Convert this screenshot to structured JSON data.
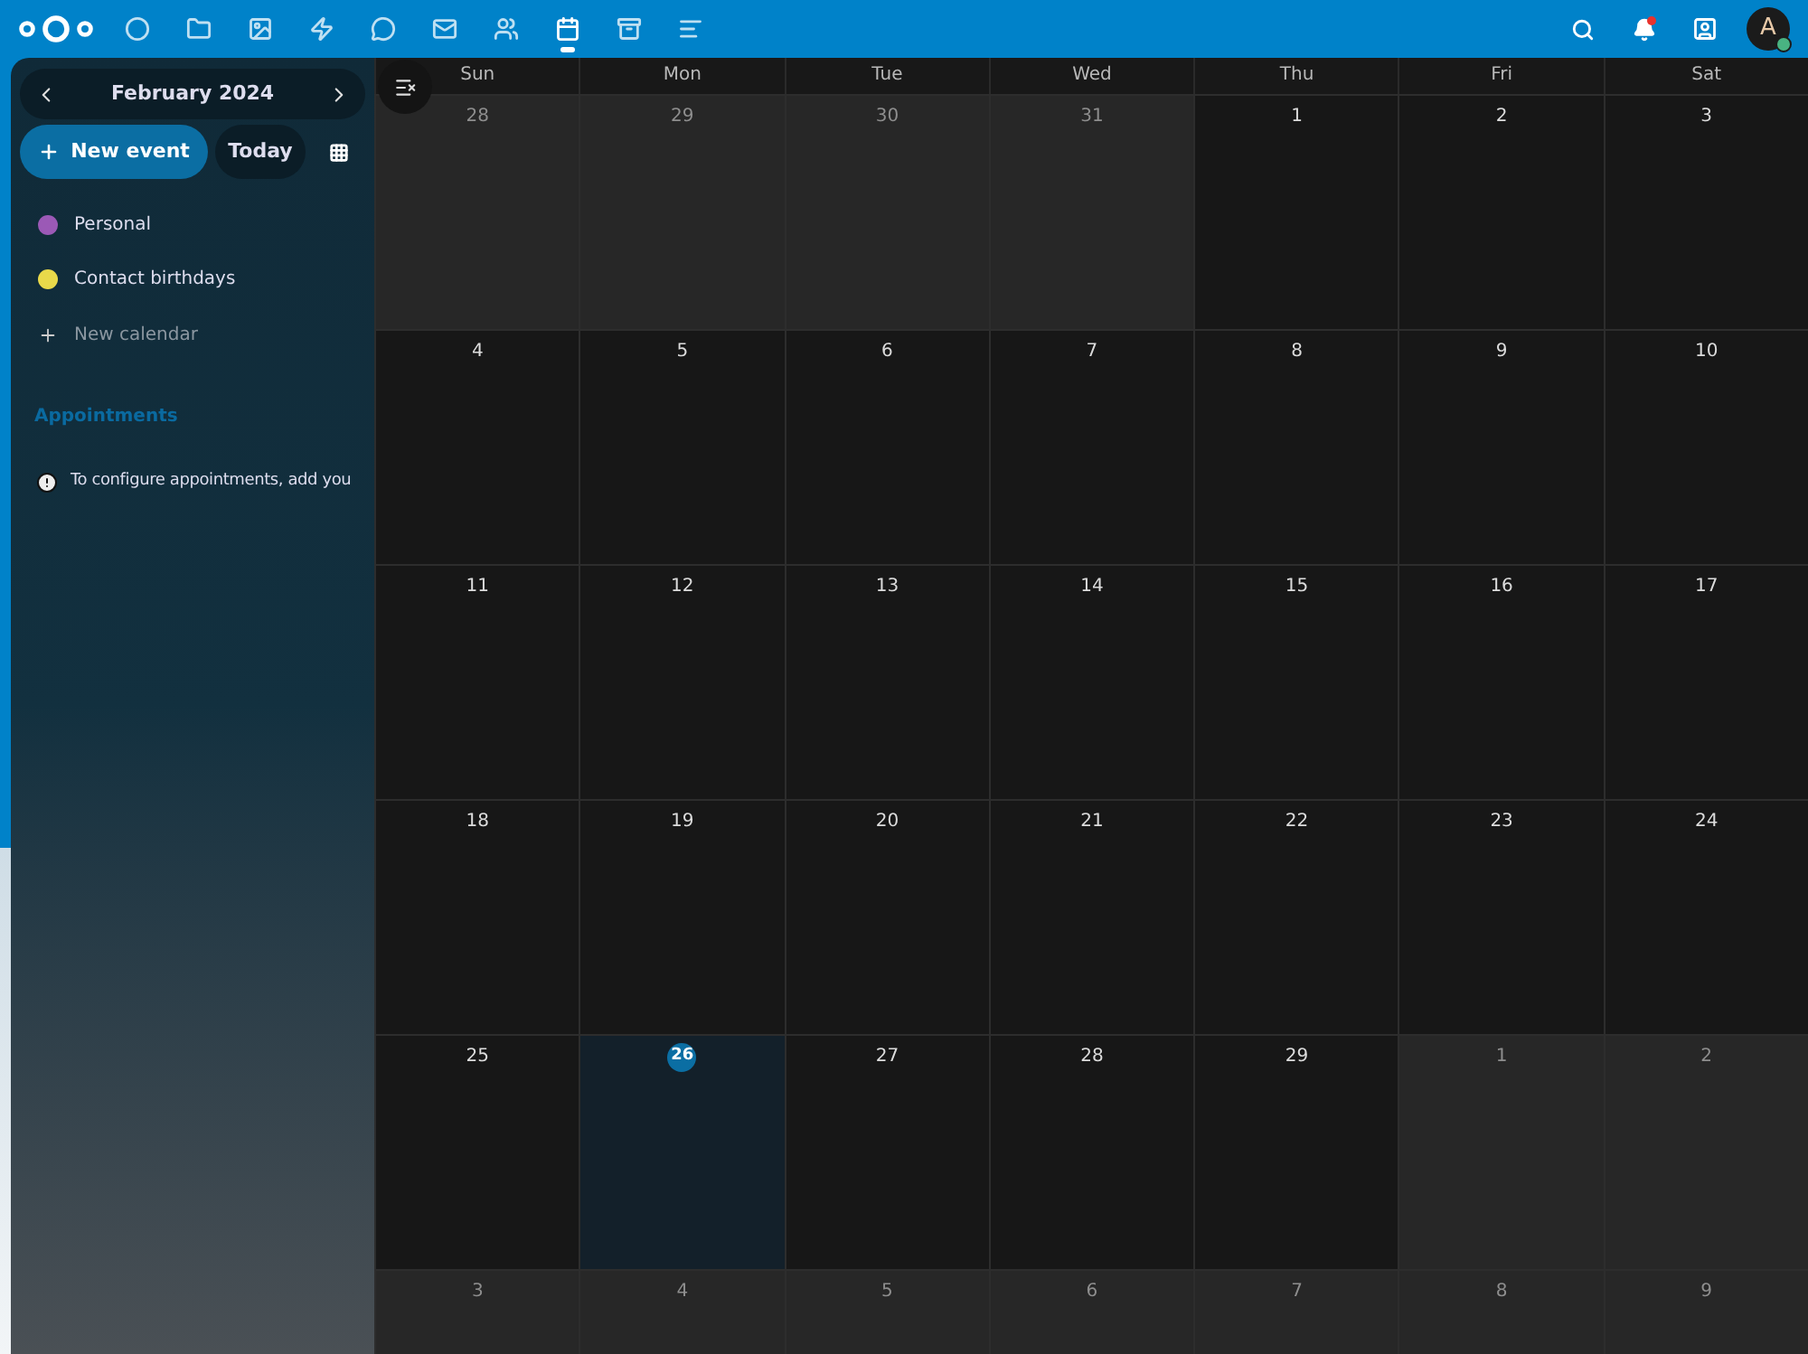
{
  "top_bar": {
    "apps": [
      {
        "kind": "dashboard",
        "selected": false
      },
      {
        "kind": "files",
        "selected": false
      },
      {
        "kind": "photos",
        "selected": false
      },
      {
        "kind": "activity",
        "selected": false
      },
      {
        "kind": "talk",
        "selected": false
      },
      {
        "kind": "mail",
        "selected": false
      },
      {
        "kind": "contacts",
        "selected": false
      },
      {
        "kind": "calendar",
        "selected": true
      },
      {
        "kind": "deck",
        "selected": false
      },
      {
        "kind": "notes",
        "selected": false
      }
    ],
    "notifications_unread": true,
    "avatar": {
      "initial": "A",
      "online": true
    }
  },
  "sidebar": {
    "month_label": "February 2024",
    "new_event": "New event",
    "today": "Today",
    "calendars": [
      {
        "name": "Personal",
        "color": "#9b59b6"
      },
      {
        "name": "Contact birthdays",
        "color": "#e9d94a"
      }
    ],
    "new_calendar": "New calendar",
    "appointments_heading": "Appointments",
    "appointments_note": "To configure appointments, add you"
  },
  "calendar": {
    "weekdays": [
      "Sun",
      "Mon",
      "Tue",
      "Wed",
      "Thu",
      "Fri",
      "Sat"
    ],
    "weeks": [
      [
        {
          "day": "28",
          "other_month": true,
          "today": false
        },
        {
          "day": "29",
          "other_month": true,
          "today": false
        },
        {
          "day": "30",
          "other_month": true,
          "today": false
        },
        {
          "day": "31",
          "other_month": true,
          "today": false
        },
        {
          "day": "1",
          "other_month": false,
          "today": false
        },
        {
          "day": "2",
          "other_month": false,
          "today": false
        },
        {
          "day": "3",
          "other_month": false,
          "today": false
        }
      ],
      [
        {
          "day": "4",
          "other_month": false,
          "today": false
        },
        {
          "day": "5",
          "other_month": false,
          "today": false
        },
        {
          "day": "6",
          "other_month": false,
          "today": false
        },
        {
          "day": "7",
          "other_month": false,
          "today": false
        },
        {
          "day": "8",
          "other_month": false,
          "today": false
        },
        {
          "day": "9",
          "other_month": false,
          "today": false
        },
        {
          "day": "10",
          "other_month": false,
          "today": false
        }
      ],
      [
        {
          "day": "11",
          "other_month": false,
          "today": false
        },
        {
          "day": "12",
          "other_month": false,
          "today": false
        },
        {
          "day": "13",
          "other_month": false,
          "today": false
        },
        {
          "day": "14",
          "other_month": false,
          "today": false
        },
        {
          "day": "15",
          "other_month": false,
          "today": false
        },
        {
          "day": "16",
          "other_month": false,
          "today": false
        },
        {
          "day": "17",
          "other_month": false,
          "today": false
        }
      ],
      [
        {
          "day": "18",
          "other_month": false,
          "today": false
        },
        {
          "day": "19",
          "other_month": false,
          "today": false
        },
        {
          "day": "20",
          "other_month": false,
          "today": false
        },
        {
          "day": "21",
          "other_month": false,
          "today": false
        },
        {
          "day": "22",
          "other_month": false,
          "today": false
        },
        {
          "day": "23",
          "other_month": false,
          "today": false
        },
        {
          "day": "24",
          "other_month": false,
          "today": false
        }
      ],
      [
        {
          "day": "25",
          "other_month": false,
          "today": false
        },
        {
          "day": "26",
          "other_month": false,
          "today": true
        },
        {
          "day": "27",
          "other_month": false,
          "today": false
        },
        {
          "day": "28",
          "other_month": false,
          "today": false
        },
        {
          "day": "29",
          "other_month": false,
          "today": false
        },
        {
          "day": "1",
          "other_month": true,
          "today": false
        },
        {
          "day": "2",
          "other_month": true,
          "today": false
        }
      ],
      [
        {
          "day": "3",
          "other_month": true,
          "today": false
        },
        {
          "day": "4",
          "other_month": true,
          "today": false
        },
        {
          "day": "5",
          "other_month": true,
          "today": false
        },
        {
          "day": "6",
          "other_month": true,
          "today": false
        },
        {
          "day": "7",
          "other_month": true,
          "today": false
        },
        {
          "day": "8",
          "other_month": true,
          "today": false
        },
        {
          "day": "9",
          "other_month": true,
          "today": false
        }
      ]
    ]
  }
}
